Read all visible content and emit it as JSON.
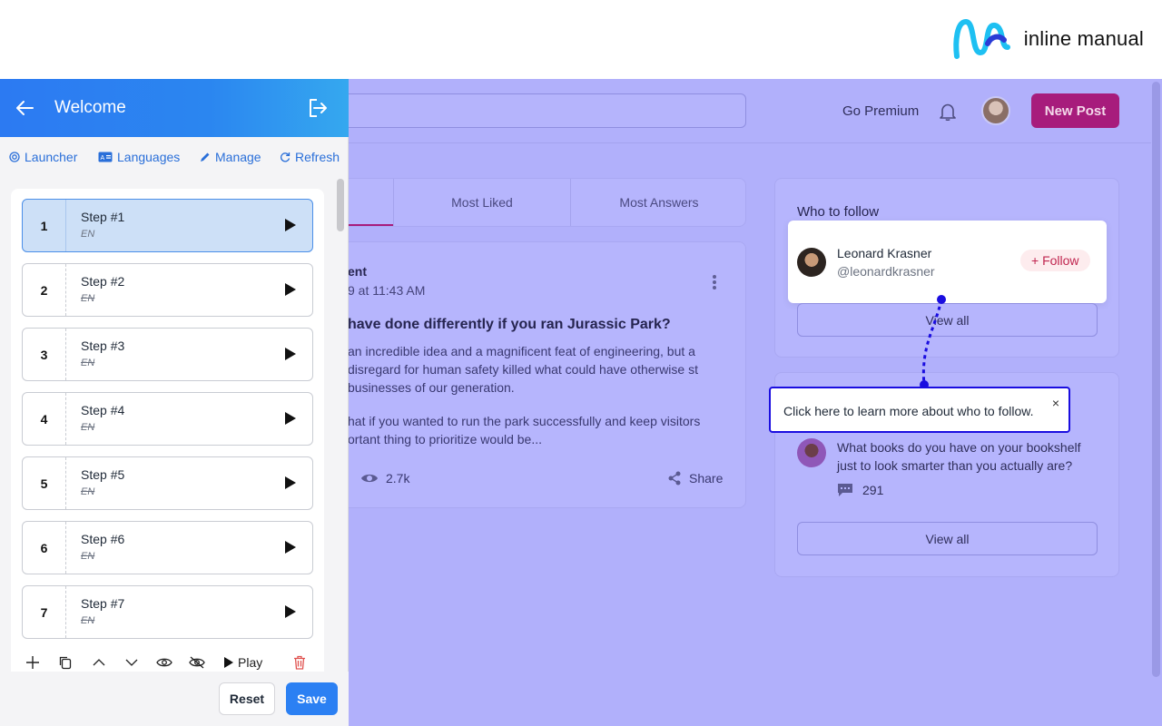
{
  "brand": {
    "name": "inline manual",
    "accent": "#22b0f0"
  },
  "app": {
    "header": {
      "go_premium": "Go Premium",
      "new_post": "New Post"
    },
    "tabs": [
      "",
      "Most Liked",
      "Most Answers"
    ],
    "post": {
      "author": "ent",
      "date": "9 at 11:43 AM",
      "title": "have done differently if you ran Jurassic Park?",
      "para1": "an incredible idea and a magnificent feat of engineering, but a disregard for human safety killed what could have otherwise st businesses of our generation.",
      "para2": "hat if you wanted to run the park successfully and keep visitors ortant thing to prioritize would be...",
      "views": "2.7k",
      "share": "Share"
    },
    "who_to_follow": {
      "title": "Who to follow",
      "user_name": "Leonard Krasner",
      "user_handle": "@leonardkrasner",
      "follow_label": "+ Follow",
      "view_all": "View all"
    },
    "questions": {
      "question": "What books do you have on your bookshelf just to look smarter than you actually are?",
      "answers": "291",
      "view_all": "View all"
    },
    "tooltip": {
      "text": "Click here to learn more about who to follow.",
      "close": "×"
    }
  },
  "panel": {
    "title": "Welcome",
    "nav": {
      "launcher": "Launcher",
      "languages": "Languages",
      "manage": "Manage",
      "refresh": "Refresh"
    },
    "steps": [
      {
        "num": "1",
        "title": "Step #1",
        "lang": "EN"
      },
      {
        "num": "2",
        "title": "Step #2",
        "lang": "EN"
      },
      {
        "num": "3",
        "title": "Step #3",
        "lang": "EN"
      },
      {
        "num": "4",
        "title": "Step #4",
        "lang": "EN"
      },
      {
        "num": "5",
        "title": "Step #5",
        "lang": "EN"
      },
      {
        "num": "6",
        "title": "Step #6",
        "lang": "EN"
      },
      {
        "num": "7",
        "title": "Step #7",
        "lang": "EN"
      }
    ],
    "toolbar": {
      "play": "Play"
    },
    "footer": {
      "reset": "Reset",
      "save": "Save"
    }
  }
}
